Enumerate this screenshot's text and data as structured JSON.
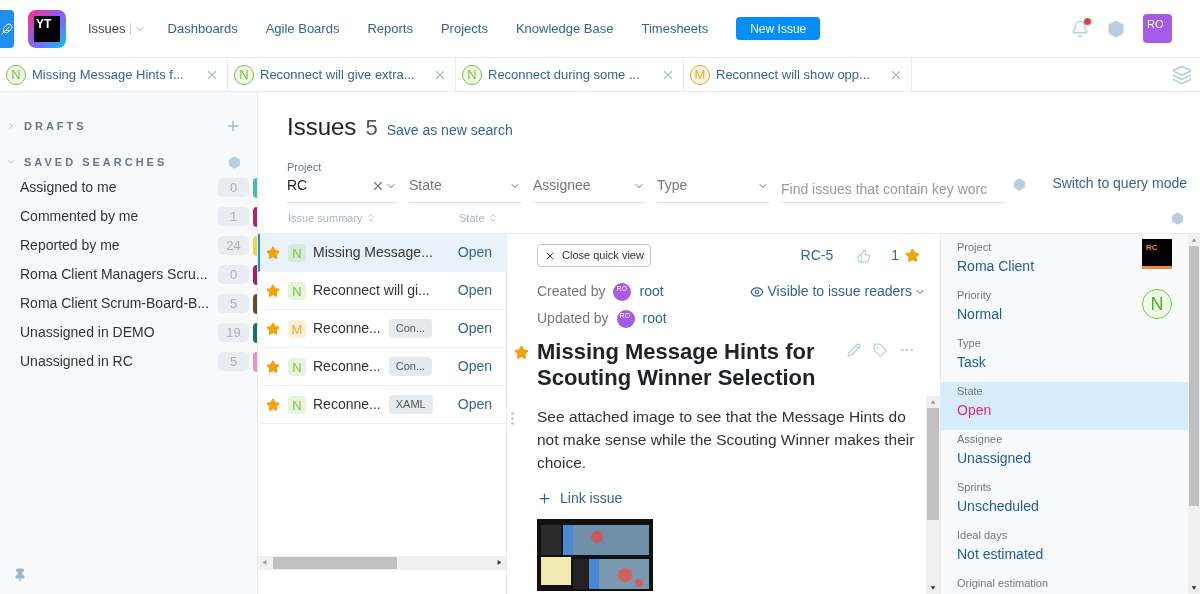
{
  "nav": {
    "items": [
      {
        "label": "Issues",
        "selected": true
      },
      {
        "label": "Dashboards",
        "selected": false
      },
      {
        "label": "Agile Boards",
        "selected": false
      },
      {
        "label": "Reports",
        "selected": false
      },
      {
        "label": "Projects",
        "selected": false
      },
      {
        "label": "Knowledge Base",
        "selected": false
      },
      {
        "label": "Timesheets",
        "selected": false
      }
    ],
    "logo": "YT",
    "new_issue": "New Issue",
    "avatar": "RO",
    "notification": true
  },
  "issue_tabs": [
    {
      "priority": "N",
      "color": "#7cc242",
      "title": "Missing Message Hints f..."
    },
    {
      "priority": "N",
      "color": "#7cc242",
      "title": "Reconnect will give extra..."
    },
    {
      "priority": "N",
      "color": "#7cc242",
      "title": "Reconnect during some ..."
    },
    {
      "priority": "M",
      "color": "#e7a92a",
      "title": "Reconnect will show opp..."
    }
  ],
  "sidebar": {
    "drafts": {
      "label": "DRAFTS",
      "expanded": false
    },
    "saved_searches": {
      "label": "SAVED SEARCHES",
      "expanded": true
    },
    "items": [
      {
        "label": "Assigned to me",
        "count": "0",
        "color": "#3fc1b0"
      },
      {
        "label": "Commented by me",
        "count": "1",
        "color": "#b0256a"
      },
      {
        "label": "Reported by me",
        "count": "24",
        "color": "#f3d34a"
      },
      {
        "label": "Roma Client Managers Scru...",
        "count": "0",
        "color": "#a2215e"
      },
      {
        "label": "Roma Client Scrum-Board-B...",
        "count": "5",
        "color": "#6b4a2b"
      },
      {
        "label": "Unassigned in DEMO",
        "count": "19",
        "color": "#1e6e6b"
      },
      {
        "label": "Unassigned in RC",
        "count": "5",
        "color": "#f28bc0"
      }
    ]
  },
  "search": {
    "title": "Issues",
    "count": "5",
    "save_link": "Save as new search",
    "filters": [
      {
        "kind": "value",
        "label": "Project",
        "value": "RC"
      },
      {
        "kind": "empty",
        "value": "State"
      },
      {
        "kind": "empty",
        "value": "Assignee"
      },
      {
        "kind": "empty",
        "value": "Type"
      }
    ],
    "placeholder": "Find issues that contain key worc",
    "query_link": "Switch to query mode"
  },
  "table": {
    "columns": [
      "Issue summary",
      "State"
    ],
    "rows": [
      {
        "starred": true,
        "priority": "N",
        "color": "#7cc242",
        "summary": "Missing Message...",
        "state": "Open",
        "selected": true
      },
      {
        "starred": true,
        "priority": "N",
        "color": "#7cc242",
        "summary": "Reconnect will gi...",
        "state": "Open",
        "selected": false
      },
      {
        "starred": true,
        "priority": "M",
        "color": "#e7a92a",
        "summary": "Reconne...",
        "tag": "Con...",
        "state": "Open",
        "selected": false
      },
      {
        "starred": true,
        "priority": "N",
        "color": "#7cc242",
        "summary": "Reconne...",
        "tag": "Con...",
        "state": "Open",
        "selected": false
      },
      {
        "starred": true,
        "priority": "N",
        "color": "#7cc242",
        "summary": "Reconne...",
        "tag": "XAML",
        "state": "Open",
        "selected": false
      }
    ]
  },
  "detail": {
    "close": "Close quick view",
    "id": "RC-5",
    "votes": "1",
    "starred": true,
    "created_label": "Created by",
    "updated_label": "Updated by",
    "created_avatar": "RO",
    "updated_avatar": "RO",
    "created_user": "root",
    "updated_user": "root",
    "visibility": "Visible to issue readers",
    "title": "Missing Message Hints for Scouting Winner Selection",
    "description": "See attached image to see that the Message Hints do not make sense while the Scouting Winner makes their choice.",
    "link_issue": "Link issue"
  },
  "fields": [
    {
      "label": "Project",
      "value": "Roma Client",
      "color": "#1f5f99",
      "selected": false,
      "kind": "project",
      "badge": "RC"
    },
    {
      "label": "Priority",
      "value": "Normal",
      "color": "#1f5f99",
      "selected": false,
      "kind": "priority",
      "badge": "N"
    },
    {
      "label": "Type",
      "value": "Task",
      "color": "#1f5f99",
      "selected": false
    },
    {
      "label": "State",
      "value": "Open",
      "color": "#e0268b",
      "selected": true
    },
    {
      "label": "Assignee",
      "value": "Unassigned",
      "color": "#1f5f99",
      "selected": false
    },
    {
      "label": "Sprints",
      "value": "Unscheduled",
      "color": "#1f5f99",
      "selected": false
    },
    {
      "label": "Ideal days",
      "value": "Not estimated",
      "color": "#1f5f99",
      "selected": false
    },
    {
      "label": "Original estimation"
    }
  ]
}
